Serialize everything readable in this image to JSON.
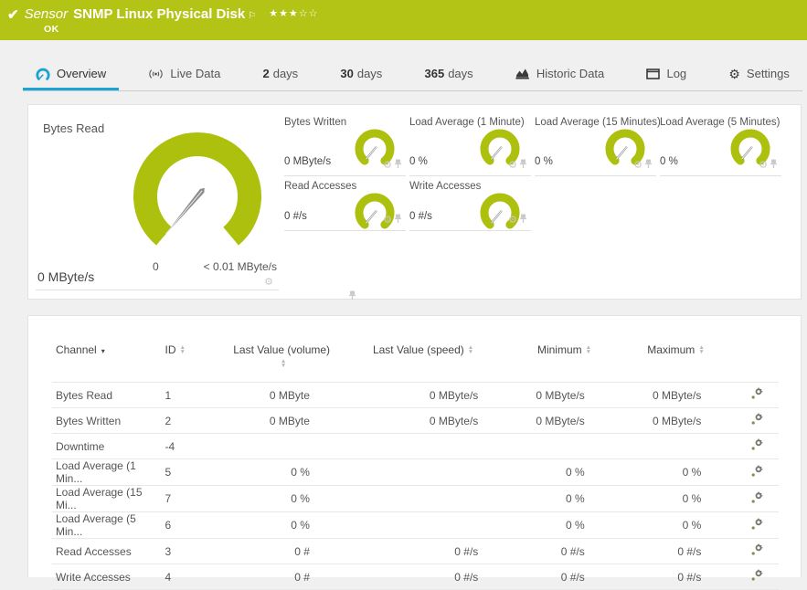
{
  "colors": {
    "header_green": "#b4c416",
    "gauge_green": "#adc00e",
    "tab_active_blue": "#1ba3d4",
    "page_bg": "#f0f0f0"
  },
  "header": {
    "prefix": "Sensor",
    "title": "SNMP Linux Physical Disk",
    "status": "OK",
    "check_icon": "✔",
    "flag_icon": "⚐",
    "stars": {
      "filled": 3,
      "empty": 2
    }
  },
  "tabs": [
    {
      "id": "overview",
      "icon": "gauge-icon",
      "label": "Overview",
      "active": true
    },
    {
      "id": "live-data",
      "icon": "live-icon",
      "label": "Live Data",
      "active": false
    },
    {
      "id": "2-days",
      "bold": "2",
      "label": "days",
      "active": false
    },
    {
      "id": "30-days",
      "bold": "30",
      "label": "days",
      "active": false
    },
    {
      "id": "365-days",
      "bold": "365",
      "label": "days",
      "active": false
    },
    {
      "id": "historic-data",
      "icon": "historic-icon",
      "label": "Historic Data",
      "active": false
    },
    {
      "id": "log",
      "icon": "log-icon",
      "label": "Log",
      "active": false
    },
    {
      "id": "settings",
      "icon": "settings-icon",
      "label": "Settings",
      "active": false
    }
  ],
  "gauges": {
    "primary": {
      "title": "Bytes Read",
      "value": "0 MByte/s",
      "scale_min": "0",
      "scale_max": "< 0.01 MByte/s"
    },
    "small": [
      {
        "title": "Bytes Written",
        "value": "0 MByte/s"
      },
      {
        "title": "Load Average (1 Minute)",
        "value": "0 %"
      },
      {
        "title": "Load Average (15 Minutes)",
        "value": "0 %"
      },
      {
        "title": "Load Average (5 Minutes)",
        "value": "0 %"
      },
      {
        "title": "Read Accesses",
        "value": "0 #/s"
      },
      {
        "title": "Write Accesses",
        "value": "0 #/s"
      }
    ]
  },
  "table": {
    "columns": [
      {
        "label": "Channel",
        "sort": "desc"
      },
      {
        "label": "ID",
        "sort": "both"
      },
      {
        "label": "Last Value (volume)",
        "sort": "both"
      },
      {
        "label": "Last Value (speed)",
        "sort": "both"
      },
      {
        "label": "Minimum",
        "sort": "both"
      },
      {
        "label": "Maximum",
        "sort": "both"
      }
    ],
    "rows": [
      {
        "channel": "Bytes Read",
        "id": "1",
        "last_volume": "0 MByte",
        "last_speed": "0 MByte/s",
        "min": "0 MByte/s",
        "max": "0 MByte/s"
      },
      {
        "channel": "Bytes Written",
        "id": "2",
        "last_volume": "0 MByte",
        "last_speed": "0 MByte/s",
        "min": "0 MByte/s",
        "max": "0 MByte/s"
      },
      {
        "channel": "Downtime",
        "id": "-4",
        "last_volume": "",
        "last_speed": "",
        "min": "",
        "max": ""
      },
      {
        "channel": "Load Average (1 Min...",
        "id": "5",
        "last_volume": "0 %",
        "last_speed": "",
        "min": "0 %",
        "max": "0 %"
      },
      {
        "channel": "Load Average (15 Mi...",
        "id": "7",
        "last_volume": "0 %",
        "last_speed": "",
        "min": "0 %",
        "max": "0 %"
      },
      {
        "channel": "Load Average (5 Min...",
        "id": "6",
        "last_volume": "0 %",
        "last_speed": "",
        "min": "0 %",
        "max": "0 %"
      },
      {
        "channel": "Read Accesses",
        "id": "3",
        "last_volume": "0 #",
        "last_speed": "0 #/s",
        "min": "0 #/s",
        "max": "0 #/s"
      },
      {
        "channel": "Write Accesses",
        "id": "4",
        "last_volume": "0 #",
        "last_speed": "0 #/s",
        "min": "0 #/s",
        "max": "0 #/s"
      }
    ]
  }
}
